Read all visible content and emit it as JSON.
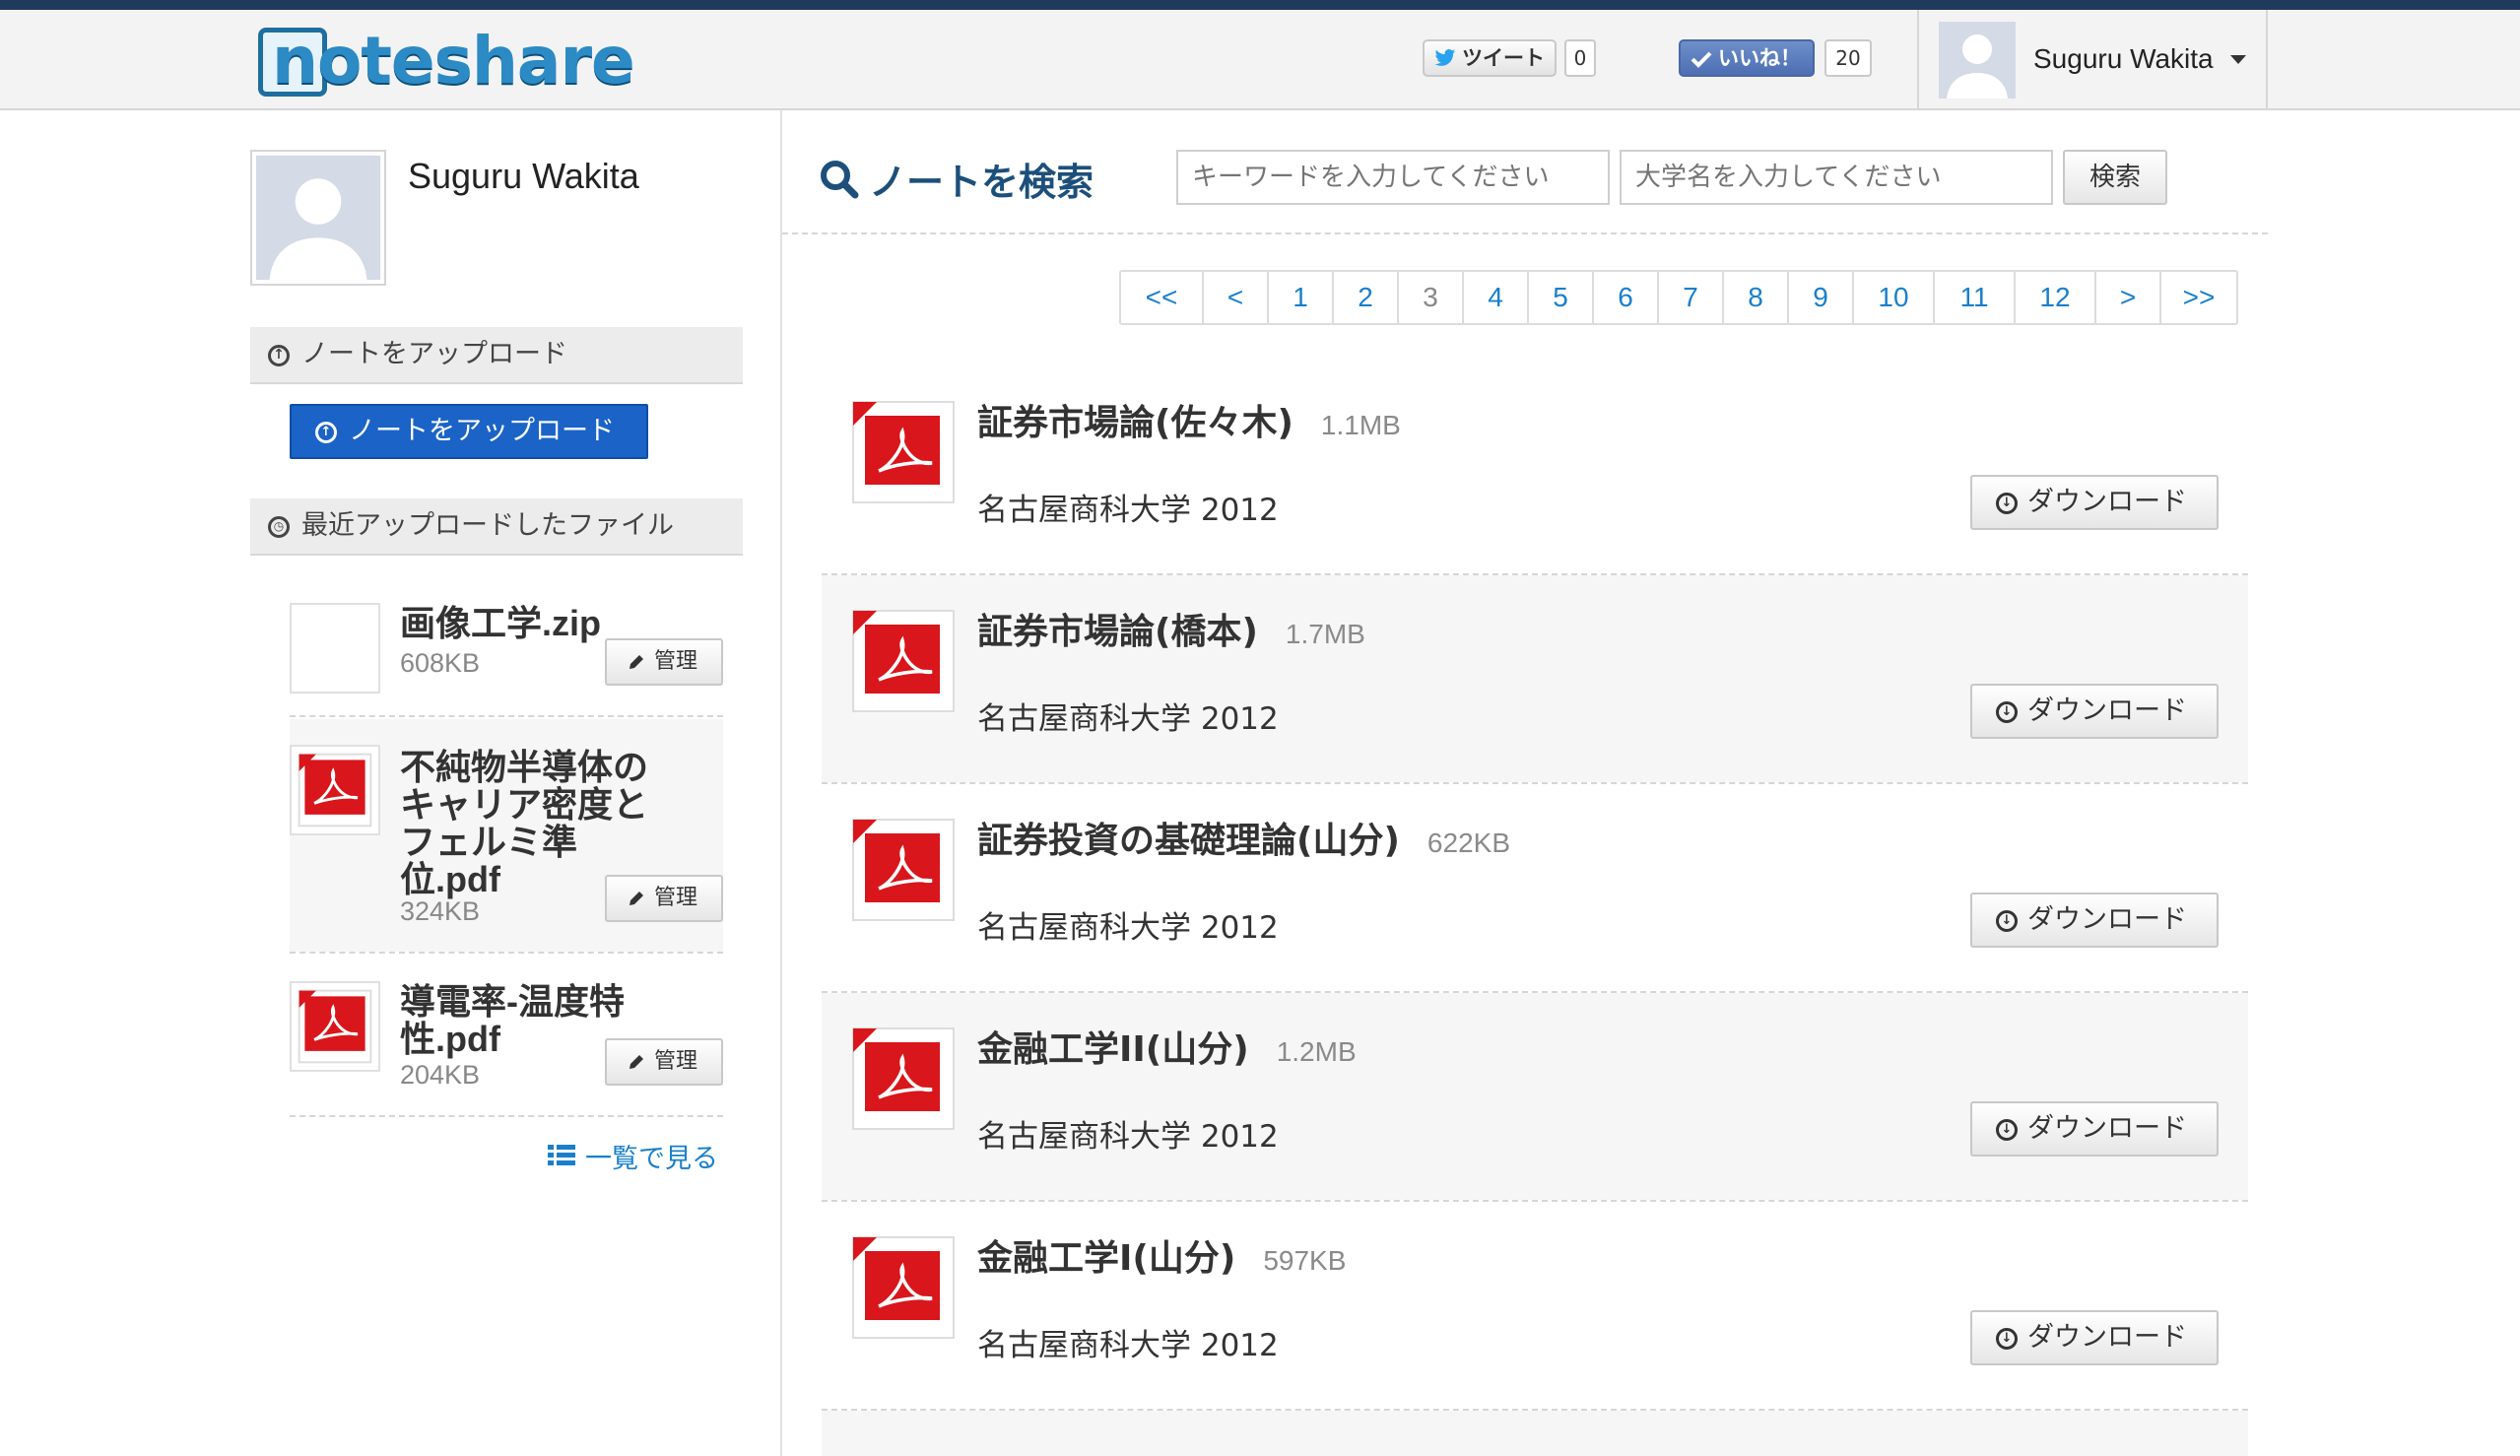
{
  "header": {
    "logo": "noteshare",
    "tweet_label": "ツイート",
    "tweet_count": "0",
    "like_label": "いいね！",
    "like_count": "20",
    "user_name": "Suguru Wakita"
  },
  "sidebar": {
    "profile_name": "Suguru Wakita",
    "upload_heading": "ノートをアップロード",
    "upload_button": "ノートをアップロード",
    "recent_heading": "最近アップロードしたファイル",
    "recent_files": [
      {
        "name": "画像工学.zip",
        "size": "608KB",
        "manage": "管理",
        "icon": "zip-file-icon"
      },
      {
        "name": "不純物半導体のキャリア密度とフェルミ準位.pdf",
        "size": "324KB",
        "manage": "管理",
        "icon": "pdf-file-icon"
      },
      {
        "name": "導電率-温度特性.pdf",
        "size": "204KB",
        "manage": "管理",
        "icon": "pdf-file-icon"
      }
    ],
    "view_list": "一覧で見る"
  },
  "search": {
    "title": "ノートを検索",
    "keyword_placeholder": "キーワードを入力してください",
    "university_placeholder": "大学名を入力してください",
    "button": "検索"
  },
  "pagination": {
    "items": [
      "<<",
      "<",
      "1",
      "2",
      "3",
      "4",
      "5",
      "6",
      "7",
      "8",
      "9",
      "10",
      "11",
      "12",
      ">",
      ">>"
    ],
    "current": "3"
  },
  "notes": [
    {
      "title": "証券市場論(佐々木)",
      "size": "1.1MB",
      "meta": "名古屋商科大学 2012",
      "download": "ダウンロード"
    },
    {
      "title": "証券市場論(橋本)",
      "size": "1.7MB",
      "meta": "名古屋商科大学 2012",
      "download": "ダウンロード"
    },
    {
      "title": "証券投資の基礎理論(山分)",
      "size": "622KB",
      "meta": "名古屋商科大学 2012",
      "download": "ダウンロード"
    },
    {
      "title": "金融工学II(山分)",
      "size": "1.2MB",
      "meta": "名古屋商科大学 2012",
      "download": "ダウンロード"
    },
    {
      "title": "金融工学I(山分)",
      "size": "597KB",
      "meta": "名古屋商科大学 2012",
      "download": "ダウンロード"
    }
  ],
  "colors": {
    "accent": "#1b63c6",
    "link": "#1a7fc9",
    "header_stripe": "#1f3a5a",
    "pdf_red": "#d8161b"
  }
}
